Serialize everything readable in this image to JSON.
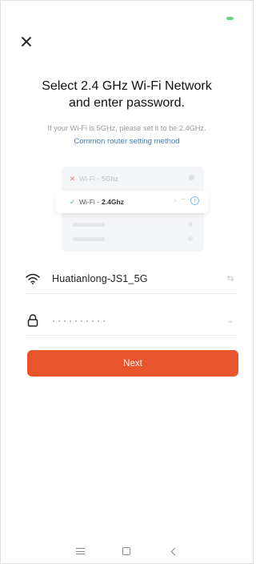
{
  "header": {
    "title_line1": "Select 2.4 GHz Wi-Fi Network",
    "title_line2": "and enter password.",
    "subtitle": "If your Wi-Fi is 5GHz, please set it to be 2.4GHz.",
    "help_link": "Common router setting method"
  },
  "illustration": {
    "bad_network": {
      "label": "Wi-Fi - ",
      "band": "5Ghz"
    },
    "good_network": {
      "label": "Wi-Fi - ",
      "band": "2.4Ghz"
    }
  },
  "form": {
    "wifi_name": "Huatianlong-JS1_5G",
    "password_mask": "··········"
  },
  "actions": {
    "next_label": "Next"
  },
  "colors": {
    "accent": "#e8542c",
    "link": "#3a7fc4",
    "success": "#3fae69",
    "error": "#e07b6e"
  },
  "icons": {
    "close": "close-icon",
    "wifi": "wifi-icon",
    "lock": "lock-icon",
    "switch_network": "swap-icon",
    "show_password": "chevron-down-icon",
    "nav_menu": "menu-icon",
    "nav_home": "home-icon",
    "nav_back": "back-icon"
  }
}
